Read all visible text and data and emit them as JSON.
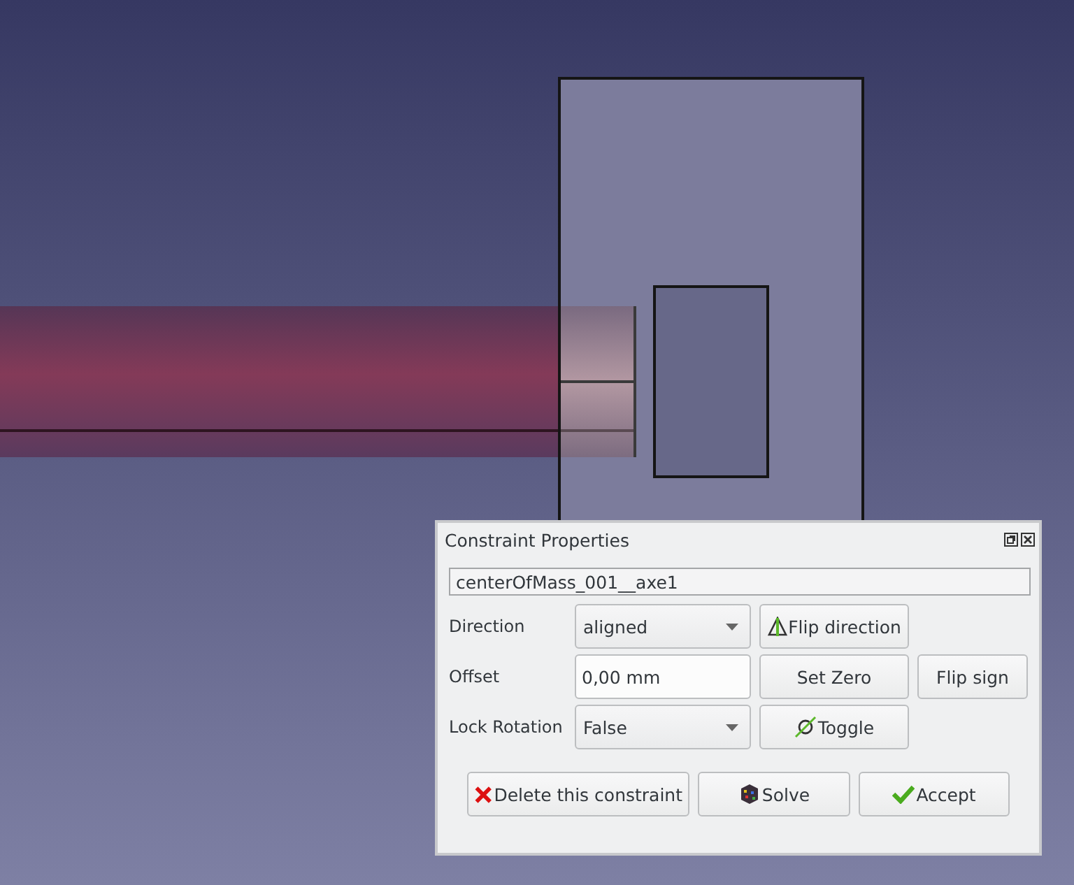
{
  "dialog": {
    "title": "Constraint Properties",
    "name_field": {
      "value": "centerOfMass_001__axe1"
    },
    "rows": [
      {
        "label": "Direction",
        "kind": "combo",
        "value": "aligned",
        "buttons": [
          {
            "label": "Flip direction"
          }
        ]
      },
      {
        "label": "Offset",
        "kind": "text",
        "value": "0,00 mm",
        "buttons": [
          {
            "label": "Set Zero"
          },
          {
            "label": "Flip sign"
          }
        ]
      },
      {
        "label": "Lock Rotation",
        "kind": "combo",
        "value": "False",
        "buttons": [
          {
            "label": "Toggle"
          }
        ]
      }
    ],
    "actions": [
      {
        "label": "Delete this constraint"
      },
      {
        "label": "Solve"
      },
      {
        "label": "Accept"
      }
    ]
  }
}
